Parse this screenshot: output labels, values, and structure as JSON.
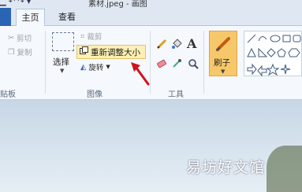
{
  "window": {
    "title": "素材.jpeg - 画图"
  },
  "tabs": {
    "home": "主页",
    "view": "查看"
  },
  "clipboard": {
    "cut": "剪切",
    "copy": "复制",
    "group_label": "剪贴板"
  },
  "image": {
    "select": "选择",
    "crop": "裁剪",
    "resize": "重新调整大小",
    "rotate": "旋转",
    "group_label": "图像"
  },
  "tools": {
    "text_tool": "A",
    "group_label": "工具"
  },
  "brush": {
    "label": "刷子"
  },
  "watermark": "易坊好文馆",
  "colors": {
    "accent_tab": "#2a64b4",
    "highlight": "#fdf0b4",
    "brush": "#f7c86a",
    "arrow": "#d0121b"
  }
}
